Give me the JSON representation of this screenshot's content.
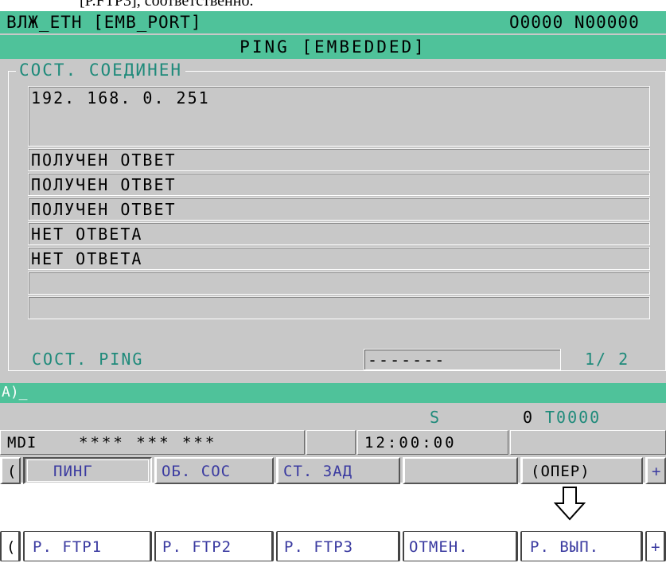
{
  "caption": "[P.FTP3], соответственно.",
  "header": {
    "left": "ВЛЖ_ETH [EMB_PORT]",
    "right": "O0000 N00000"
  },
  "subheader": "PING [EMBEDDED]",
  "section_title": "СОСТ. СОЕДИНЕН",
  "address": "192. 168. 0. 251",
  "results": [
    "ПОЛУЧЕН ОТВЕТ",
    "ПОЛУЧЕН ОТВЕТ",
    "ПОЛУЧЕН ОТВЕТ",
    "НЕТ ОТВЕТА",
    "НЕТ ОТВЕТА",
    "",
    ""
  ],
  "status": {
    "label": "СОСТ. PING",
    "value": "-------",
    "page": "1/ 2"
  },
  "input_prompt": "A)_",
  "spindle": {
    "s_label": "S",
    "s_value": "0",
    "t_value": "T0000"
  },
  "mode_bar": {
    "mode": "MDI",
    "status": "**** *** ***",
    "time": "12:00:00"
  },
  "softkeys": {
    "left_arrow": "(",
    "items": [
      "ПИНГ",
      "ОБ. СОС",
      "СТ. ЗАД",
      "",
      "(ОПЕР)"
    ],
    "right_plus": "+"
  },
  "bottom_softkeys": {
    "left_arrow": "(",
    "items": [
      "Р. FTP1",
      "Р. FTP2",
      "Р. FTP3",
      "ОТМЕН.",
      "Р. ВЫП."
    ],
    "right_plus": "+"
  },
  "colors": {
    "bar": "#4fc29a",
    "screen_bg": "#c8c8c8",
    "label_teal": "#1e8a7a",
    "key_text": "#3a3aa0"
  }
}
